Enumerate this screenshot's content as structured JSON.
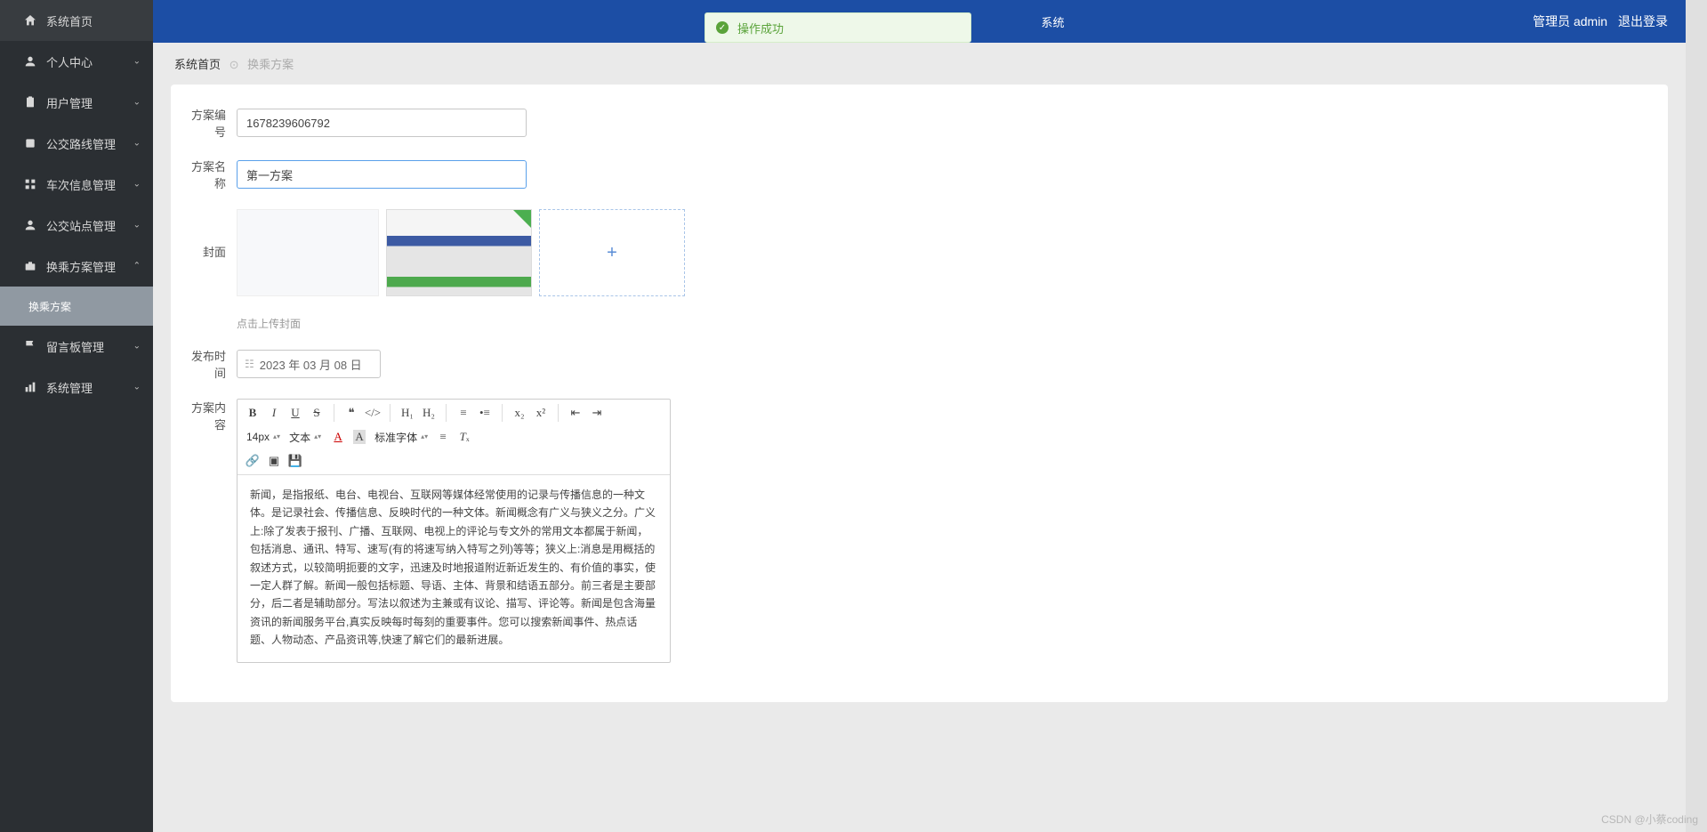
{
  "header": {
    "system_suffix": "系统",
    "user_label": "管理员 admin",
    "logout_label": "退出登录"
  },
  "toast": {
    "message": "操作成功"
  },
  "sidebar": {
    "items": [
      {
        "label": "系统首页",
        "icon": "home",
        "expandable": false
      },
      {
        "label": "个人中心",
        "icon": "user",
        "expandable": true
      },
      {
        "label": "用户管理",
        "icon": "clipboard",
        "expandable": true
      },
      {
        "label": "公交路线管理",
        "icon": "route",
        "expandable": true
      },
      {
        "label": "车次信息管理",
        "icon": "grid",
        "expandable": true
      },
      {
        "label": "公交站点管理",
        "icon": "pin",
        "expandable": true
      },
      {
        "label": "换乘方案管理",
        "icon": "briefcase",
        "expandable": true,
        "expanded": true
      },
      {
        "label": "留言板管理",
        "icon": "flag",
        "expandable": true
      },
      {
        "label": "系统管理",
        "icon": "bar",
        "expandable": true
      }
    ],
    "sub_item": "换乘方案"
  },
  "breadcrumb": {
    "home": "系统首页",
    "current": "换乘方案"
  },
  "form": {
    "plan_id": {
      "label": "方案编号",
      "value": "1678239606792"
    },
    "plan_name": {
      "label": "方案名称",
      "value": "第一方案"
    },
    "cover": {
      "label": "封面",
      "hint": "点击上传封面"
    },
    "publish": {
      "label": "发布时间",
      "value": "2023 年 03 月 08 日"
    },
    "content": {
      "label": "方案内容"
    }
  },
  "editor": {
    "font_size": "14px",
    "font_type": "文本",
    "font_family": "标准字体",
    "body": "新闻，是指报纸、电台、电视台、互联网等媒体经常使用的记录与传播信息的一种文体。是记录社会、传播信息、反映时代的一种文体。新闻概念有广义与狭义之分。广义上:除了发表于报刊、广播、互联网、电视上的评论与专文外的常用文本都属于新闻，包括消息、通讯、特写、速写(有的将速写纳入特写之列)等等；狭义上:消息是用概括的叙述方式，以较简明扼要的文字，迅速及时地报道附近新近发生的、有价值的事实，使一定人群了解。新闻一般包括标题、导语、主体、背景和结语五部分。前三者是主要部分，后二者是辅助部分。写法以叙述为主兼或有议论、描写、评论等。新闻是包含海量资讯的新闻服务平台,真实反映每时每刻的重要事件。您可以搜索新闻事件、热点话题、人物动态、产品资讯等,快速了解它们的最新进展。"
  },
  "watermark": "CSDN @小蔡coding"
}
